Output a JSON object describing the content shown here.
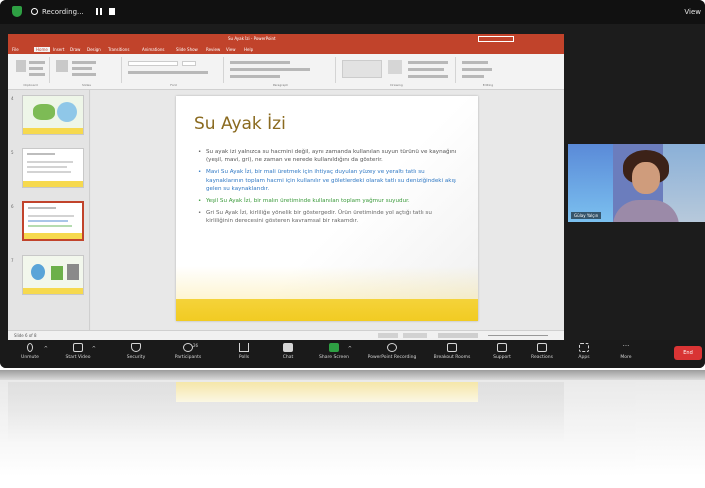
{
  "os_bar": {
    "recording_label": "Recording...",
    "view_label": "View"
  },
  "powerpoint": {
    "title": "Su Ayak İzi - PowerPoint",
    "tabs": [
      "File",
      "Home",
      "Insert",
      "Draw",
      "Design",
      "Transitions",
      "Animations",
      "Slide Show",
      "Review",
      "View",
      "Help"
    ],
    "active_tab": "Home",
    "ribbon_groups": [
      "Clipboard",
      "Slides",
      "Font",
      "Paragraph",
      "Drawing",
      "Editing"
    ],
    "thumbnail_numbers": [
      "4",
      "5",
      "6",
      "7"
    ],
    "status_text": "Slide 6 of 8"
  },
  "slide": {
    "title": "Su Ayak İzi",
    "bullets": [
      {
        "text": "Su ayak izi yalnızca su hacmini değil, aynı zamanda kullanılan suyun türünü ve kaynağını (yeşil, mavi, gri), ne zaman ve nerede kullanıldığını da gösterir.",
        "color": "#555555"
      },
      {
        "text": "Mavi Su Ayak İzi, bir mali üretmek için ihtiyaç duyulan yüzey ve yeraltı tatlı su kaynaklarının toplam hacmi için kullanılır ve göletlerdeki olarak tatlı su deniziğindeki akış gelen su kaynaklarıdır.",
        "color": "#2f78c4"
      },
      {
        "text": "Yeşil Su Ayak İzi, bir malın üretiminde kullanılan toplam yağmur suyudur.",
        "color": "#3a9a3a"
      },
      {
        "text": "Gri Su Ayak İzi, kirliliğe yönelik bir göstergedir. Ürün üretiminde yol açtığı tatlı su kirliliğinin derecesini gösteren kavramsal bir rakamdır.",
        "color": "#666666"
      }
    ]
  },
  "video": {
    "participant_name": "Gülay Yalçın"
  },
  "toolbar": {
    "items": [
      {
        "label": "Unmute",
        "icon": "microphone-icon"
      },
      {
        "label": "Start Video",
        "icon": "camera-icon"
      },
      {
        "label": "Security",
        "icon": "shield-icon"
      },
      {
        "label": "Participants",
        "icon": "participants-icon",
        "count": "26"
      },
      {
        "label": "Polls",
        "icon": "poll-icon"
      },
      {
        "label": "Chat",
        "icon": "chat-icon"
      },
      {
        "label": "Share Screen",
        "icon": "share-screen-icon"
      },
      {
        "label": "PowerPoint Recording",
        "icon": "record-icon"
      },
      {
        "label": "Breakout Rooms",
        "icon": "breakout-rooms-icon"
      },
      {
        "label": "Support",
        "icon": "support-icon"
      },
      {
        "label": "Reactions",
        "icon": "reactions-icon"
      },
      {
        "label": "Apps",
        "icon": "apps-icon"
      },
      {
        "label": "More",
        "icon": "more-icon"
      }
    ],
    "end_label": "End"
  },
  "colors": {
    "ppt_accent": "#c1432b",
    "slide_title": "#8a6a1f",
    "slide_band": "#f3d12d",
    "zoom_green": "#2ea043",
    "end_red": "#d93434"
  }
}
